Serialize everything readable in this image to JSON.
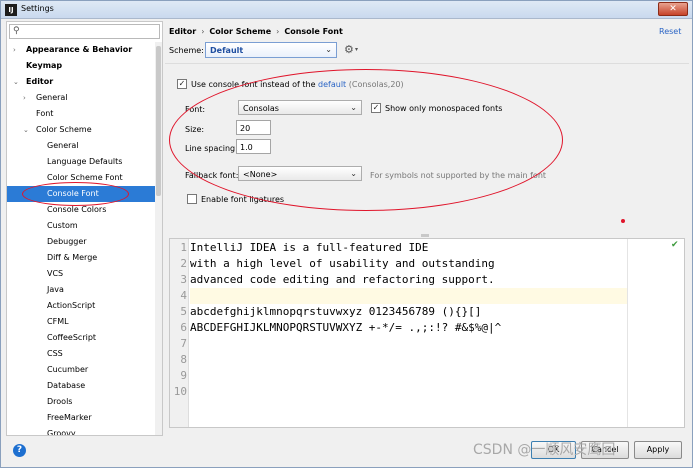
{
  "window": {
    "title": "Settings",
    "icon_letter": "IJ",
    "close_glyph": "✕"
  },
  "sidebar": {
    "search_placeholder": "",
    "items": [
      {
        "label": "Appearance & Behavior",
        "level": 0,
        "bold": true,
        "arrow": "›"
      },
      {
        "label": "Keymap",
        "level": 0,
        "bold": true,
        "arrow": ""
      },
      {
        "label": "Editor",
        "level": 0,
        "bold": true,
        "arrow": "⌄"
      },
      {
        "label": "General",
        "level": 1,
        "bold": false,
        "arrow": "›"
      },
      {
        "label": "Font",
        "level": 1,
        "bold": false,
        "arrow": ""
      },
      {
        "label": "Color Scheme",
        "level": 1,
        "bold": false,
        "arrow": "⌄"
      },
      {
        "label": "General",
        "level": 2,
        "bold": false,
        "arrow": ""
      },
      {
        "label": "Language Defaults",
        "level": 2,
        "bold": false,
        "arrow": ""
      },
      {
        "label": "Color Scheme Font",
        "level": 2,
        "bold": false,
        "arrow": ""
      },
      {
        "label": "Console Font",
        "level": 2,
        "bold": false,
        "arrow": "",
        "selected": true
      },
      {
        "label": "Console Colors",
        "level": 2,
        "bold": false,
        "arrow": ""
      },
      {
        "label": "Custom",
        "level": 2,
        "bold": false,
        "arrow": ""
      },
      {
        "label": "Debugger",
        "level": 2,
        "bold": false,
        "arrow": ""
      },
      {
        "label": "Diff & Merge",
        "level": 2,
        "bold": false,
        "arrow": ""
      },
      {
        "label": "VCS",
        "level": 2,
        "bold": false,
        "arrow": ""
      },
      {
        "label": "Java",
        "level": 2,
        "bold": false,
        "arrow": ""
      },
      {
        "label": "ActionScript",
        "level": 2,
        "bold": false,
        "arrow": ""
      },
      {
        "label": "CFML",
        "level": 2,
        "bold": false,
        "arrow": ""
      },
      {
        "label": "CoffeeScript",
        "level": 2,
        "bold": false,
        "arrow": ""
      },
      {
        "label": "CSS",
        "level": 2,
        "bold": false,
        "arrow": ""
      },
      {
        "label": "Cucumber",
        "level": 2,
        "bold": false,
        "arrow": ""
      },
      {
        "label": "Database",
        "level": 2,
        "bold": false,
        "arrow": ""
      },
      {
        "label": "Drools",
        "level": 2,
        "bold": false,
        "arrow": ""
      },
      {
        "label": "FreeMarker",
        "level": 2,
        "bold": false,
        "arrow": ""
      },
      {
        "label": "Groovy",
        "level": 2,
        "bold": false,
        "arrow": ""
      }
    ]
  },
  "breadcrumb": {
    "items": [
      "Editor",
      "Color Scheme",
      "Console Font"
    ],
    "sep": "›"
  },
  "reset_label": "Reset",
  "scheme": {
    "label": "Scheme:",
    "value": "Default"
  },
  "console_font": {
    "use_console_font_prefix": "Use console font instead of the",
    "use_console_font_link": "default",
    "use_console_font_suffix": "(Consolas,20)",
    "use_console_font_checked": true,
    "font_label": "Font:",
    "font_value": "Consolas",
    "monospaced_label": "Show only monospaced fonts",
    "monospaced_checked": true,
    "size_label": "Size:",
    "size_value": "20",
    "line_spacing_label": "Line spacing:",
    "line_spacing_value": "1.0",
    "fallback_label": "Fallback font:",
    "fallback_value": "<None>",
    "fallback_hint": "For symbols not supported by the main font",
    "ligatures_label": "Enable font ligatures",
    "ligatures_checked": false
  },
  "editor": {
    "lines": [
      {
        "n": "1",
        "text": "IntelliJ IDEA is a full-featured IDE"
      },
      {
        "n": "2",
        "text": "with a high level of usability and outstanding"
      },
      {
        "n": "3",
        "text": "advanced code editing and refactoring support."
      },
      {
        "n": "4",
        "text": "",
        "current": true
      },
      {
        "n": "5",
        "text": "abcdefghijklmnopqrstuvwxyz 0123456789 (){}[]"
      },
      {
        "n": "6",
        "text": "ABCDEFGHIJKLMNOPQRSTUVWXYZ +-*/= .,;:!? #&$%@|^"
      },
      {
        "n": "7",
        "text": ""
      },
      {
        "n": "8",
        "text": ""
      },
      {
        "n": "9",
        "text": ""
      },
      {
        "n": "10",
        "text": ""
      }
    ]
  },
  "footer": {
    "ok": "OK",
    "cancel": "Cancel",
    "apply": "Apply"
  },
  "watermark": "CSDN @一顺风安鹰回"
}
